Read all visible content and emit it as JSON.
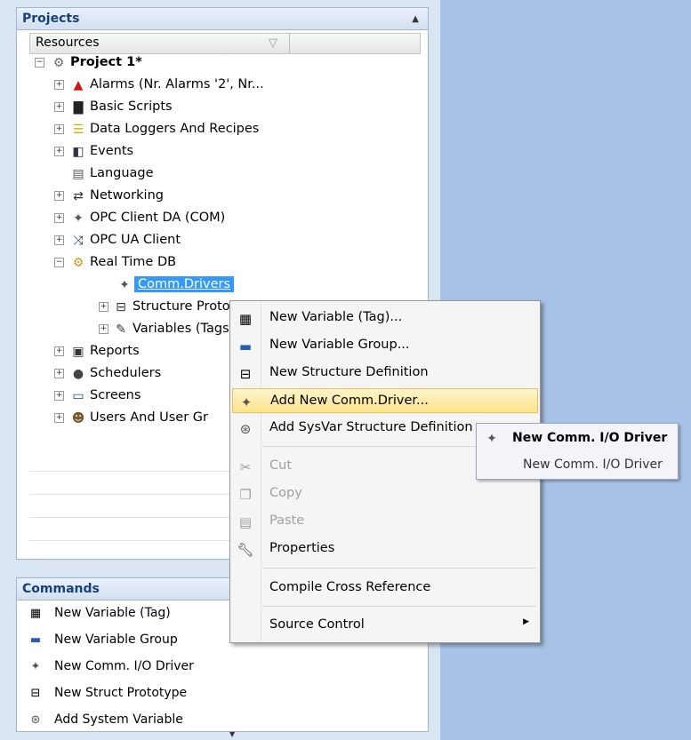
{
  "projects_panel": {
    "title": "Projects",
    "resources_header": "Resources",
    "filter_icon": "filter-icon",
    "tree": [
      {
        "label": "Project 1*",
        "level": 0,
        "expander": "minus",
        "icon": "gear-icon",
        "bold": true
      },
      {
        "label": "Alarms (Nr. Alarms '2', Nr...",
        "level": 1,
        "expander": "plus",
        "icon": "bell-icon"
      },
      {
        "label": "Basic Scripts",
        "level": 1,
        "expander": "plus",
        "icon": "script-icon"
      },
      {
        "label": "Data Loggers And Recipes",
        "level": 1,
        "expander": "plus",
        "icon": "database-icon"
      },
      {
        "label": "Events",
        "level": 1,
        "expander": "plus",
        "icon": "event-icon"
      },
      {
        "label": "Language",
        "level": 1,
        "expander": "none",
        "icon": "language-icon"
      },
      {
        "label": "Networking",
        "level": 1,
        "expander": "plus",
        "icon": "networking-icon"
      },
      {
        "label": "OPC Client DA (COM)",
        "level": 1,
        "expander": "plus",
        "icon": "opc-icon"
      },
      {
        "label": "OPC UA Client",
        "level": 1,
        "expander": "plus",
        "icon": "opc-ua-icon"
      },
      {
        "label": "Real Time DB",
        "level": 1,
        "expander": "minus",
        "icon": "rtdb-icon"
      },
      {
        "label": "Comm.Drivers",
        "level": 2,
        "expander": "none",
        "icon": "comm-driver-icon",
        "selected": true
      },
      {
        "label": "Structure Proto",
        "level": 2,
        "expander": "plus",
        "icon": "structure-icon"
      },
      {
        "label": "Variables (Tags",
        "level": 2,
        "expander": "plus",
        "icon": "variables-icon"
      },
      {
        "label": "Reports",
        "level": 1,
        "expander": "plus",
        "icon": "reports-icon"
      },
      {
        "label": "Schedulers",
        "level": 1,
        "expander": "plus",
        "icon": "scheduler-icon"
      },
      {
        "label": "Screens",
        "level": 1,
        "expander": "plus",
        "icon": "screen-icon"
      },
      {
        "label": "Users And User Gr",
        "level": 1,
        "expander": "plus",
        "icon": "users-icon"
      }
    ]
  },
  "commands_panel": {
    "title": "Commands",
    "items": [
      {
        "label": "New Variable (Tag)",
        "icon": "new-variable-icon"
      },
      {
        "label": "New Variable Group",
        "icon": "new-variable-group-icon"
      },
      {
        "label": "New Comm. I/O Driver",
        "icon": "comm-driver-icon"
      },
      {
        "label": "New Struct Prototype",
        "icon": "structure-icon"
      },
      {
        "label": "Add System Variable",
        "icon": "system-variable-icon"
      }
    ]
  },
  "context_menu": {
    "items": [
      {
        "label": "New Variable (Tag)...",
        "icon": "new-variable-icon",
        "enabled": true
      },
      {
        "label": "New Variable Group...",
        "icon": "new-variable-group-icon",
        "enabled": true
      },
      {
        "label": "New Structure Definition",
        "icon": "structure-icon",
        "enabled": true
      },
      {
        "label": "Add New Comm.Driver...",
        "icon": "comm-driver-icon",
        "enabled": true,
        "highlighted": true
      },
      {
        "label": "Add SysVar Structure Definition",
        "icon": "system-variable-icon",
        "enabled": true
      },
      {
        "label": "Cut",
        "icon": "cut-icon",
        "enabled": false
      },
      {
        "label": "Copy",
        "icon": "copy-icon",
        "enabled": false
      },
      {
        "label": "Paste",
        "icon": "paste-icon",
        "enabled": false
      },
      {
        "label": "Properties",
        "icon": "wrench-icon",
        "enabled": true
      },
      {
        "label": "Compile Cross Reference",
        "icon": "",
        "enabled": true
      },
      {
        "label": "Source Control",
        "icon": "",
        "enabled": true,
        "has_submenu": true
      }
    ]
  },
  "tooltip": {
    "title": "New Comm. I/O Driver",
    "description": "New Comm. I/O Driver",
    "icon": "comm-driver-icon"
  }
}
